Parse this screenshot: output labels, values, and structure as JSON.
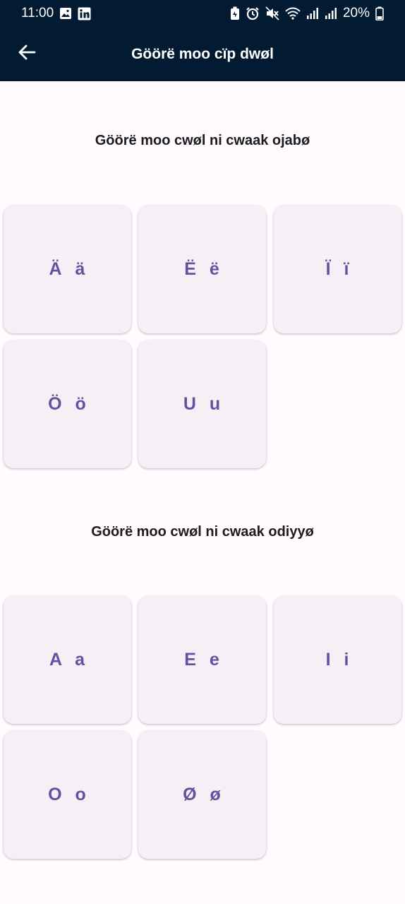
{
  "status_bar": {
    "time": "11:00",
    "battery": "20%",
    "left_icons": [
      "image-icon",
      "linkedin-icon"
    ],
    "right_icons": [
      "battery-saver-icon",
      "alarm-icon",
      "mute-icon",
      "wifi-icon",
      "signal-icon",
      "signal-icon-2",
      "battery-icon"
    ]
  },
  "app_bar": {
    "title": "Göörë moo cïp dwøl",
    "back_icon": "arrow-back-icon"
  },
  "sections": [
    {
      "title": "Göörë moo cwøl ni cwaak ojabø",
      "tiles": [
        "Ä ä",
        "Ë ë",
        "Ï ï",
        "Ö ö",
        "U u"
      ]
    },
    {
      "title": "Göörë moo cwøl ni cwaak odiyyø",
      "tiles": [
        "A a",
        "E e",
        "I i",
        "O o",
        "Ø ø"
      ]
    }
  ],
  "colors": {
    "app_bar_bg": "#031a33",
    "page_bg": "#fffbfe",
    "tile_bg": "#f4f0f6",
    "tile_text": "#6a4fa0",
    "heading_text": "#1c1b1f"
  }
}
